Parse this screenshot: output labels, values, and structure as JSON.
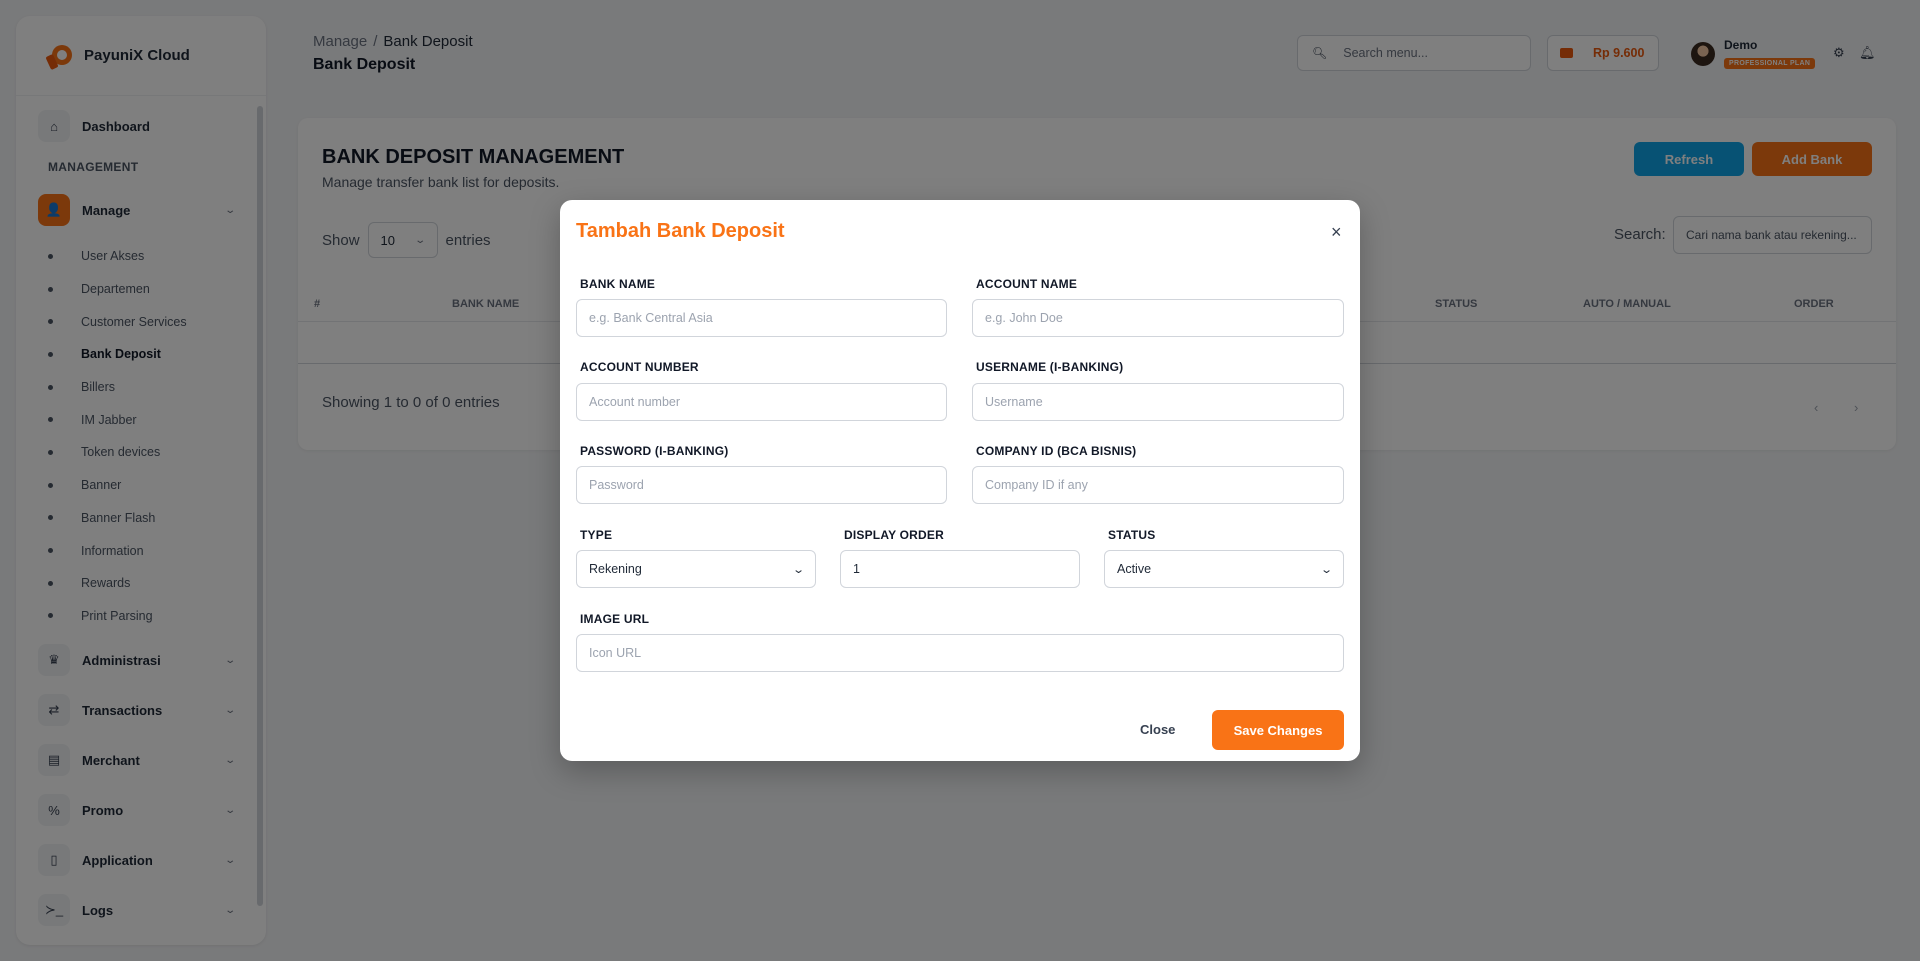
{
  "brand": {
    "name": "PayuniX Cloud"
  },
  "sidebar": {
    "dashboard": "Dashboard",
    "section": "MANAGEMENT",
    "manage": "Manage",
    "manage_items": [
      "User Akses",
      "Departemen",
      "Customer Services",
      "Bank Deposit",
      "Billers",
      "IM Jabber",
      "Token devices",
      "Banner",
      "Banner Flash",
      "Information",
      "Rewards",
      "Print Parsing"
    ],
    "groups": [
      "Administrasi",
      "Transactions",
      "Merchant",
      "Promo",
      "Application",
      "Logs"
    ]
  },
  "header": {
    "breadcrumb_parent": "Manage",
    "breadcrumb_sep": "/",
    "breadcrumb_current": "Bank Deposit",
    "page_title": "Bank Deposit",
    "search_placeholder": "Search menu...",
    "balance": "Rp 9.600",
    "user_name": "Demo",
    "plan": "PROFESSIONAL PLAN"
  },
  "card": {
    "title": "BANK DEPOSIT MANAGEMENT",
    "subtitle": "Manage transfer bank list for deposits.",
    "refresh": "Refresh",
    "add_bank": "Add Bank",
    "show": "Show",
    "page_size": "10",
    "entries": "entries",
    "search_label": "Search:",
    "search_placeholder": "Cari nama bank atau rekening...",
    "columns": [
      "#",
      "BANK NAME",
      "STATUS",
      "AUTO / MANUAL",
      "ORDER"
    ],
    "showing": "Showing 1 to 0 of 0 entries",
    "prev": "‹",
    "next": "›"
  },
  "modal": {
    "title": "Tambah Bank Deposit",
    "close_x": "×",
    "bank_name_label": "BANK NAME",
    "bank_name_placeholder": "e.g. Bank Central Asia",
    "account_name_label": "ACCOUNT NAME",
    "account_name_placeholder": "e.g. John Doe",
    "account_number_label": "ACCOUNT NUMBER",
    "account_number_placeholder": "Account number",
    "username_label": "USERNAME (I-BANKING)",
    "username_placeholder": "Username",
    "password_label": "PASSWORD (I-BANKING)",
    "password_placeholder": "Password",
    "company_label": "COMPANY ID (BCA BISNIS)",
    "company_placeholder": "Company ID if any",
    "type_label": "TYPE",
    "type_value": "Rekening",
    "order_label": "DISPLAY ORDER",
    "order_value": "1",
    "status_label": "STATUS",
    "status_value": "Active",
    "image_label": "IMAGE URL",
    "image_placeholder": "Icon URL",
    "close": "Close",
    "save": "Save Changes"
  },
  "colors": {
    "accent": "#f97316",
    "info": "#0ea5e9"
  }
}
